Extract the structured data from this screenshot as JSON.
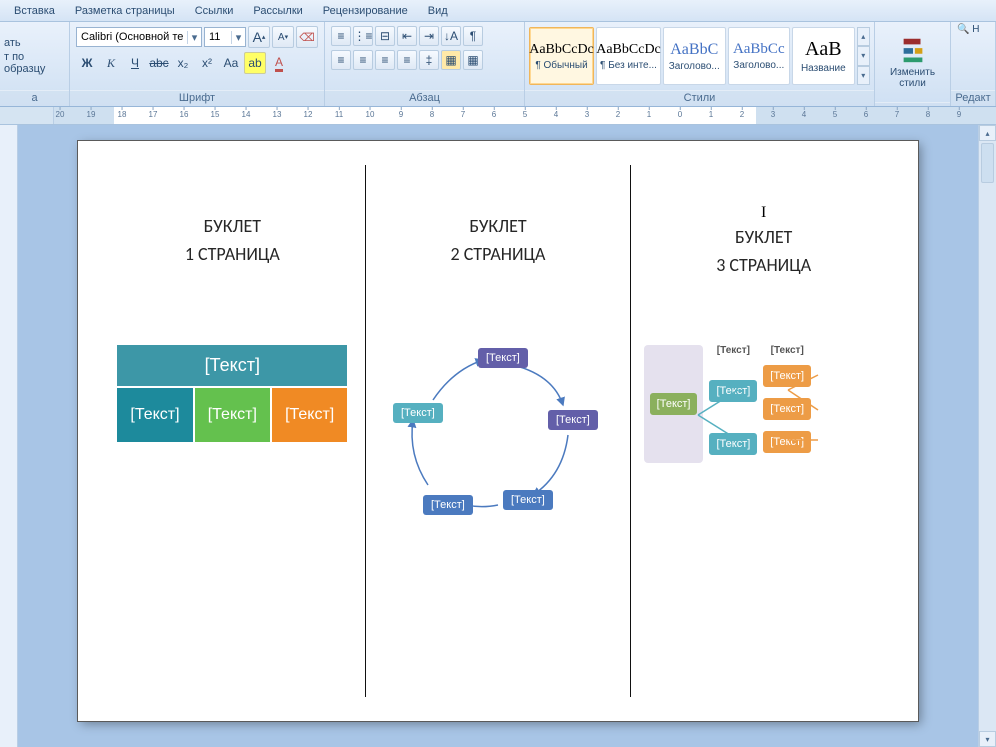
{
  "menu": {
    "items": [
      "Вставка",
      "Разметка страницы",
      "Ссылки",
      "Рассылки",
      "Рецензирование",
      "Вид"
    ]
  },
  "ribbon": {
    "clipboard": {
      "cut": "ать",
      "format": "т по образцу",
      "label": "а"
    },
    "font": {
      "name": "Calibri (Основной те",
      "size": "11",
      "label": "Шрифт",
      "bold": "Ж",
      "italic": "К",
      "underline": "Ч",
      "strike": "abc",
      "sub": "x₂",
      "sup": "x²",
      "case": "Aa",
      "highlight": "ab",
      "color": "A",
      "grow": "A",
      "shrink": "A",
      "clear": "Aa"
    },
    "paragraph": {
      "label": "Абзац"
    },
    "styles": {
      "label": "Стили",
      "items": [
        {
          "preview": "AaBbCcDc",
          "name": "¶ Обычный",
          "selected": true
        },
        {
          "preview": "AaBbCcDc",
          "name": "¶ Без инте..."
        },
        {
          "preview": "AaBbC",
          "name": "Заголово..."
        },
        {
          "preview": "AaBbCc",
          "name": "Заголово..."
        },
        {
          "preview": "AaB",
          "name": "Название"
        }
      ],
      "change": "Изменить\nстили"
    },
    "editing": {
      "find": "Н",
      "edit": "Редакт"
    }
  },
  "doc": {
    "panes": [
      {
        "title": "БУКЛЕТ",
        "sub": "1 СТРАНИЦА"
      },
      {
        "title": "БУКЛЕТ",
        "sub": "2 СТРАНИЦА"
      },
      {
        "roman": "I",
        "title": "БУКЛЕТ",
        "sub": "3 СТРАНИЦА"
      }
    ],
    "sa1": {
      "header": "[Текст]",
      "cells": [
        "[Текст]",
        "[Текст]",
        "[Текст]"
      ]
    },
    "sa2": {
      "nodes": [
        "[Текст]",
        "[Текст]",
        "[Текст]",
        "[Текст]",
        "[Текст]"
      ]
    },
    "sa3": {
      "col_labels": [
        "[Текст]",
        "[Текст]"
      ],
      "root": "[Текст]",
      "mids": [
        "[Текст]",
        "[Текст]"
      ],
      "leaves": [
        "[Текст]",
        "[Текст]",
        "[Текст]"
      ]
    }
  },
  "ruler_numbers": [
    "20",
    "19",
    "18",
    "17",
    "16",
    "15",
    "14",
    "13",
    "12",
    "11",
    "10",
    "9",
    "8",
    "7",
    "6",
    "5",
    "4",
    "3",
    "2",
    "1",
    "0",
    "1",
    "2",
    "3",
    "4",
    "5",
    "6",
    "7",
    "8",
    "9"
  ]
}
